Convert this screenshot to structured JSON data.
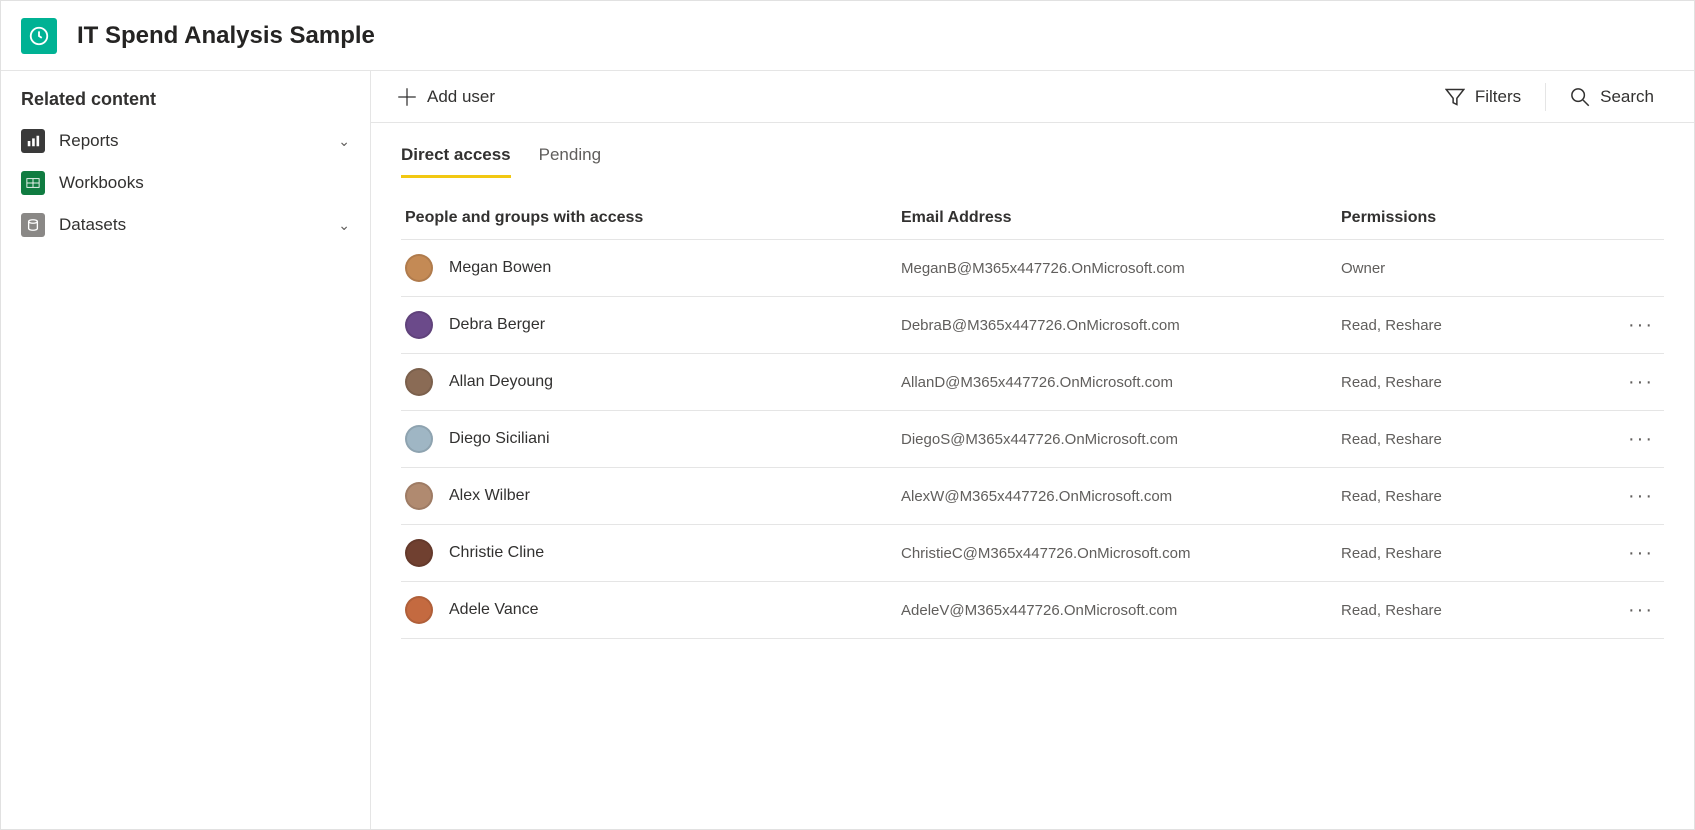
{
  "header": {
    "title": "IT Spend Analysis Sample"
  },
  "sidebar": {
    "heading": "Related content",
    "items": [
      {
        "label": "Reports",
        "icon": "reports",
        "expandable": true
      },
      {
        "label": "Workbooks",
        "icon": "workbooks",
        "expandable": false
      },
      {
        "label": "Datasets",
        "icon": "datasets",
        "expandable": true
      }
    ]
  },
  "toolbar": {
    "add_user_label": "Add user",
    "filters_label": "Filters",
    "search_label": "Search"
  },
  "tabs": [
    {
      "label": "Direct access",
      "active": true
    },
    {
      "label": "Pending",
      "active": false
    }
  ],
  "table": {
    "headers": {
      "people": "People and groups with access",
      "email": "Email Address",
      "permissions": "Permissions"
    },
    "rows": [
      {
        "name": "Megan Bowen",
        "email": "MeganB@M365x447726.OnMicrosoft.com",
        "permission": "Owner",
        "avatar": "#c48a55",
        "more": false
      },
      {
        "name": "Debra Berger",
        "email": "DebraB@M365x447726.OnMicrosoft.com",
        "permission": "Read, Reshare",
        "avatar": "#6b4a8a",
        "more": true
      },
      {
        "name": "Allan Deyoung",
        "email": "AllanD@M365x447726.OnMicrosoft.com",
        "permission": "Read, Reshare",
        "avatar": "#8a6b55",
        "more": true
      },
      {
        "name": "Diego Siciliani",
        "email": "DiegoS@M365x447726.OnMicrosoft.com",
        "permission": "Read, Reshare",
        "avatar": "#9fb6c4",
        "more": true
      },
      {
        "name": "Alex Wilber",
        "email": "AlexW@M365x447726.OnMicrosoft.com",
        "permission": "Read, Reshare",
        "avatar": "#b08a70",
        "more": true
      },
      {
        "name": "Christie Cline",
        "email": "ChristieC@M365x447726.OnMicrosoft.com",
        "permission": "Read, Reshare",
        "avatar": "#704030",
        "more": true
      },
      {
        "name": "Adele Vance",
        "email": "AdeleV@M365x447726.OnMicrosoft.com",
        "permission": "Read, Reshare",
        "avatar": "#c46a40",
        "more": true
      }
    ]
  }
}
